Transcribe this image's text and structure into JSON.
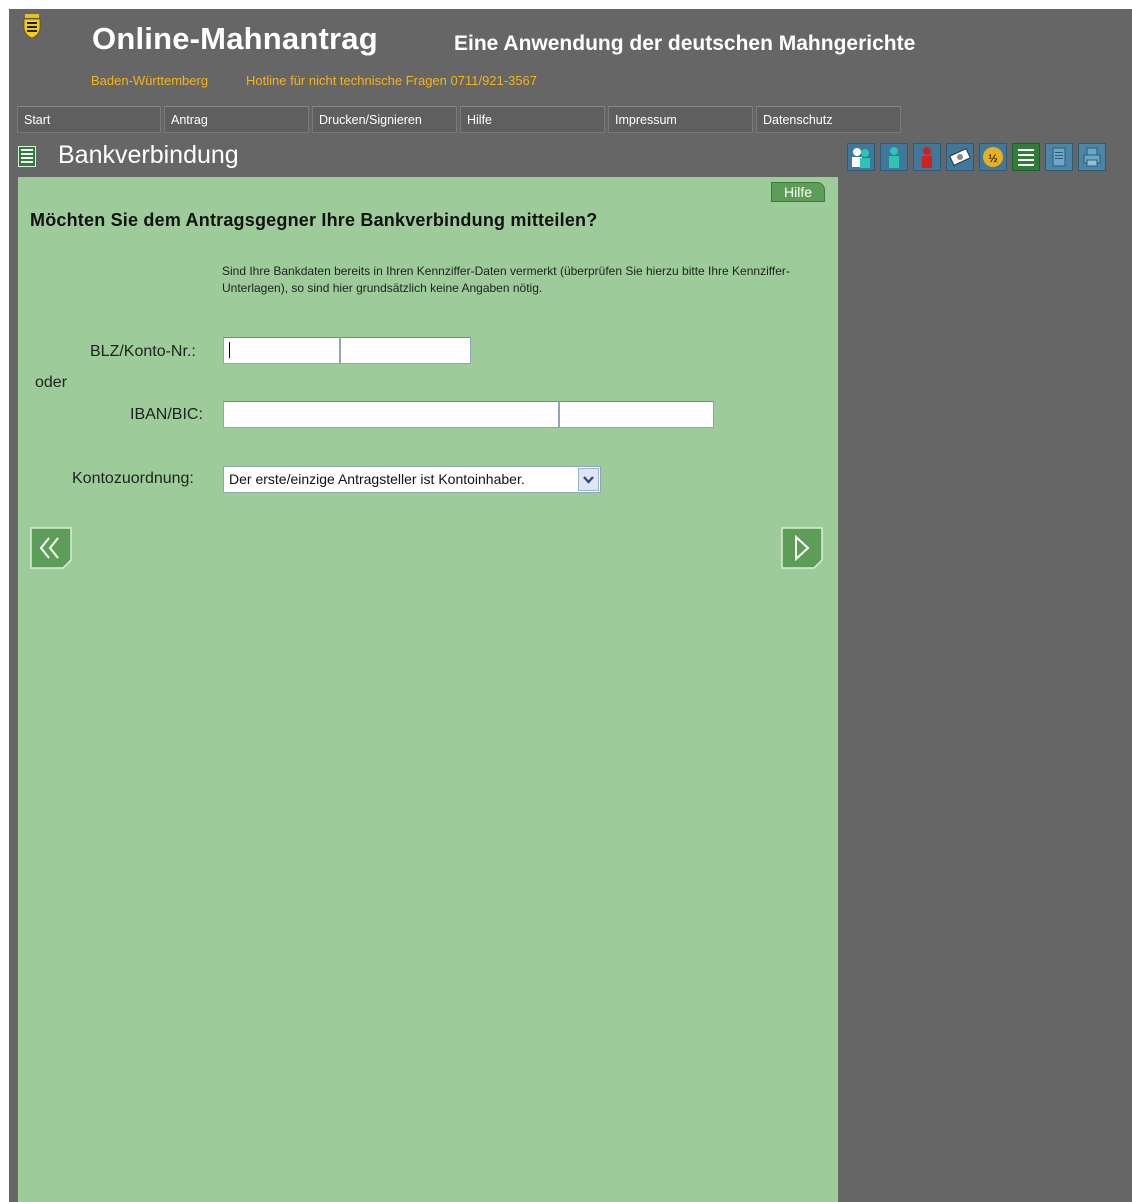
{
  "header": {
    "title": "Online-Mahnantrag",
    "subtitle": "Eine Anwendung der deutschen Mahngerichte",
    "state": "Baden-Württemberg",
    "hotline": "Hotline für nicht technische Fragen 0711/921-3567",
    "crest_icon": "coat-of-arms-icon"
  },
  "nav": {
    "items": [
      {
        "label": "Start"
      },
      {
        "label": "Antrag"
      },
      {
        "label": "Drucken/Signieren"
      },
      {
        "label": "Hilfe"
      },
      {
        "label": "Impressum"
      },
      {
        "label": "Datenschutz"
      }
    ]
  },
  "page": {
    "title": "Bankverbindung",
    "step_icons": [
      "people-icon",
      "person-teal-icon",
      "person-red-icon",
      "payment-icon",
      "numbered-circle-icon",
      "list-icon",
      "document-icon",
      "printer-icon"
    ]
  },
  "form": {
    "help_label": "Hilfe",
    "question": "Möchten Sie dem Antragsgegner Ihre Bankverbindung mitteilen?",
    "info": "Sind Ihre Bankdaten bereits in Ihren Kennziffer-Daten vermerkt (überprüfen Sie hierzu bitte Ihre Kennziffer-Unterlagen), so sind hier grundsätzlich keine Angaben nötig.",
    "blz_label": "BLZ/Konto-Nr.:",
    "oder_label": "oder",
    "iban_label": "IBAN/BIC:",
    "kontozuordnung_label": "Kontozuordnung:",
    "blz_value": "",
    "konto_value": "",
    "iban_value": "",
    "bic_value": "",
    "kontozuordnung_value": "Der erste/einzige Antragsteller ist Kontoinhaber."
  },
  "colors": {
    "background": "#666666",
    "panel": "#9dcc9a",
    "accent": "#f4b41a",
    "button_green": "#5c9e57"
  }
}
